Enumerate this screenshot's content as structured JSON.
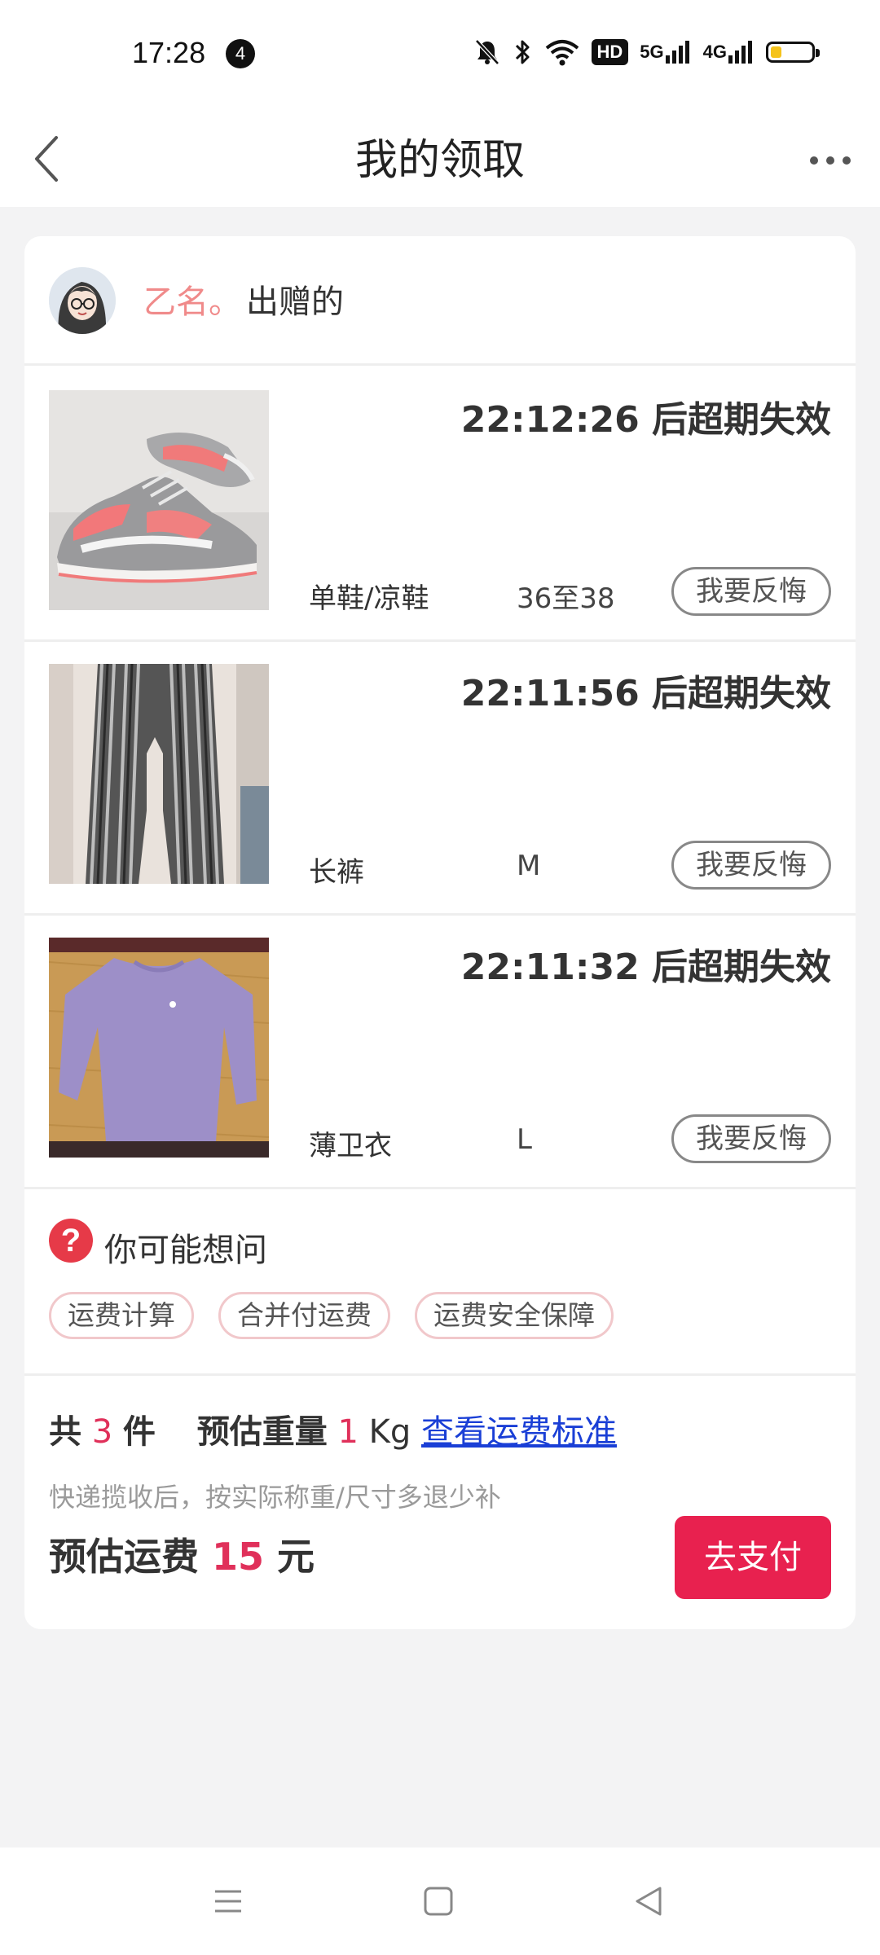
{
  "status_bar": {
    "time": "17:28",
    "notification_count": "4",
    "hd_label": "HD",
    "network_5g": "5G",
    "network_4g": "4G",
    "battery_level": 0.35,
    "battery_color": "#f5c31c"
  },
  "header": {
    "title": "我的领取",
    "back_icon": "chevron-left-icon",
    "more_icon": "more-horizontal-icon"
  },
  "donor": {
    "name": "乙名。",
    "suffix": "出赠的"
  },
  "items": [
    {
      "countdown": "22:12:26 后超期失效",
      "category": "单鞋/凉鞋",
      "size": "36至38",
      "action": "我要反悔",
      "photo": "pink-gray-sneaker"
    },
    {
      "countdown": "22:11:56 后超期失效",
      "category": "长裤",
      "size": "M",
      "action": "我要反悔",
      "photo": "striped-pants"
    },
    {
      "countdown": "22:11:32 后超期失效",
      "category": "薄卫衣",
      "size": "L",
      "action": "我要反悔",
      "photo": "lavender-long-sleeve-top"
    }
  ],
  "faq": {
    "title": "你可能想问",
    "icon": "question-icon",
    "tags": [
      "运费计算",
      "合并付运费",
      "运费安全保障"
    ]
  },
  "summary": {
    "total_prefix": "共",
    "total_count": "3",
    "total_unit": "件",
    "weight_label": "预估重量",
    "weight_value": "1",
    "weight_unit": "Kg",
    "shipping_link": "查看运费标准",
    "note": "快递揽收后，按实际称重/尺寸多退少补",
    "fee_label": "预估运费",
    "fee_value": "15",
    "fee_unit": "元",
    "pay_button": "去支付"
  },
  "colors": {
    "accent": "#e8214f",
    "donor_name": "#f08a8a",
    "link": "#1a3fd6",
    "faq_icon": "#e63a48"
  }
}
